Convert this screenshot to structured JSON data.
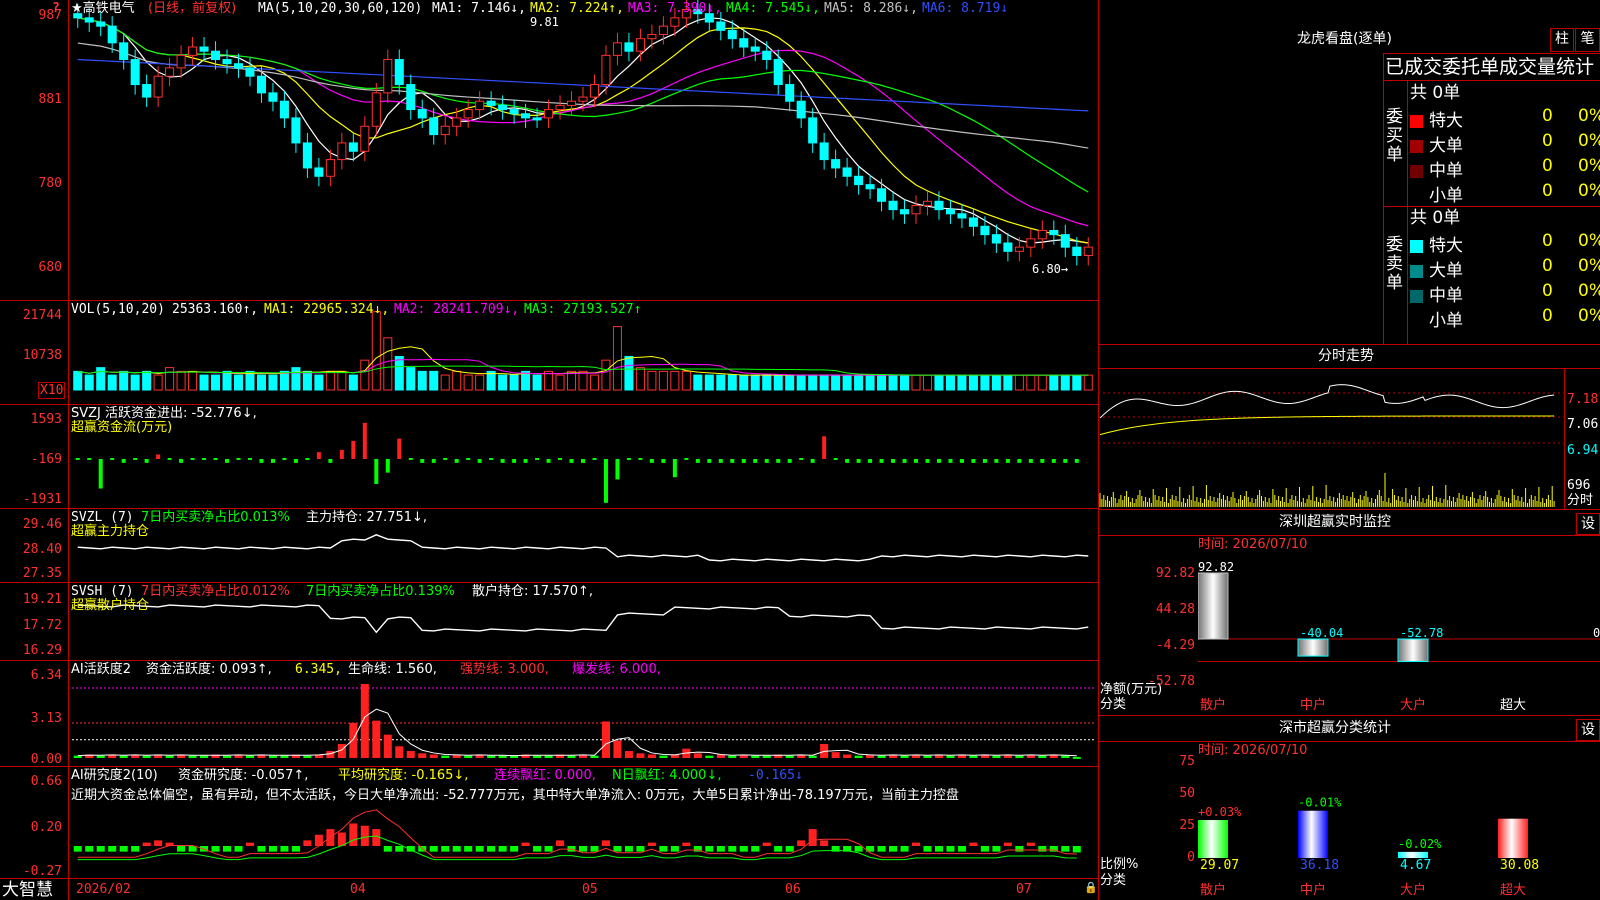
{
  "colors": {
    "up": "#ff3030",
    "down": "#00ffff",
    "frame": "#c00000",
    "ma1": "#ffffff",
    "ma2": "#ffff00",
    "ma3": "#ff00ff",
    "ma4": "#00ff00",
    "ma5": "#c0c0c0",
    "ma6": "#3050ff"
  },
  "header": {
    "corner": "?",
    "stock": "★高铁电气",
    "period": "(日线，前复权)",
    "ma_params": "MA(5,10,20,30,60,120)",
    "ma1": "MA1: 7.146↓,",
    "ma2": "MA2: 7.224↑,",
    "ma3": "MA3: 7.390↓,",
    "ma4": "MA4: 7.545↓,",
    "ma5": "MA5: 8.286↓,",
    "ma6": "MA6: 8.719↓",
    "high_mark": "9.81",
    "low_mark": "6.80→"
  },
  "price_axis": [
    "987",
    "881",
    "780",
    "680"
  ],
  "vol": {
    "label": "VOL(5,10,20)",
    "v": "25363.160↑,",
    "ma1": "MA1: 22965.324↓,",
    "ma2": "MA2: 28241.709↓,",
    "ma3": "MA3: 27193.527↑",
    "axis": [
      "21744",
      "10738"
    ],
    "unit": "X10"
  },
  "svzj": {
    "label": "SVZJ  活跃资金进出: -52.776↓,",
    "sub": "超赢资金流(万元)",
    "axis": [
      "1593",
      "-169",
      "-1931"
    ]
  },
  "svzl": {
    "label": "SVZL (7)",
    "a": "7日内买卖净占比0.013%",
    "b": "主力持仓: 27.751↓,",
    "sub": "超赢主力持仓",
    "axis": [
      "29.46",
      "28.40",
      "27.35"
    ]
  },
  "svsh": {
    "label": "SVSH (7)",
    "a": "7日内买卖净占比0.012%",
    "b": "7日内买卖净占比0.139%",
    "c": "散户持仓: 17.570↑,",
    "sub": "超赢散户持仓",
    "axis": [
      "19.21",
      "17.72",
      "16.29"
    ]
  },
  "ai1": {
    "label": "AI活跃度2",
    "a": "资金活跃度: 0.093↑,",
    "b": "6.345,",
    "c": "生命线: 1.560,",
    "d": "强势线: 3.000,",
    "e": "爆发线: 6.000,",
    "axis": [
      "6.34",
      "3.13",
      "0.00"
    ]
  },
  "ai2": {
    "label": "AI研究度2(10)",
    "a": "资金研究度: -0.057↑,",
    "b": "平均研究度: -0.165↓,",
    "c": "连续飘红: 0.000,",
    "d": "N日飘红: 4.000↓,",
    "e": "-0.165↓",
    "text": "近期大资金总体偏空，虽有异动，但不太活跃，今日大单净流出: -52.777万元，其中特大单净流入: 0万元，大单5日累计净出-78.197万元，当前主力控盘",
    "axis": [
      "0.66",
      "0.20",
      "-0.27"
    ]
  },
  "xaxis": {
    "brand": "大智慧",
    "labels": [
      "2026/02",
      "04",
      "05",
      "06",
      "07"
    ]
  },
  "dragon": {
    "title": "龙虎看盘(逐单)",
    "btn1": "柱",
    "btn2": "笔",
    "subtitle": "已成交委托单成交量统计",
    "buy": {
      "side": "委买单",
      "total": "共 0单",
      "rows": [
        {
          "name": "特大",
          "v": "0",
          "p": "0%"
        },
        {
          "name": "大单",
          "v": "0",
          "p": "0%"
        },
        {
          "name": "中单",
          "v": "0",
          "p": "0%"
        },
        {
          "name": "小单",
          "v": "0",
          "p": "0%"
        }
      ]
    },
    "sell": {
      "side": "委卖单",
      "total": "共 0单",
      "rows": [
        {
          "name": "特大",
          "v": "0",
          "p": "0%"
        },
        {
          "name": "大单",
          "v": "0",
          "p": "0%"
        },
        {
          "name": "中单",
          "v": "0",
          "p": "0%"
        },
        {
          "name": "小单",
          "v": "0",
          "p": "0%"
        }
      ]
    }
  },
  "intraday": {
    "title": "分时走势",
    "axis": [
      "7.18",
      "7.06",
      "6.94"
    ],
    "vol": "696",
    "vol_label": "分时"
  },
  "sz_monitor": {
    "title": "深圳超赢实时监控",
    "set": "设",
    "time": "时间: 2026/07/10",
    "axis": [
      "92.82",
      "44.28",
      "-4.29",
      "-52.78"
    ],
    "ylabel": "净额(万元)",
    "xlabel": "分类",
    "cats": [
      "散户",
      "中户",
      "大户",
      "超大"
    ],
    "values": [
      "92.82",
      "-40.04",
      "-52.78",
      "0"
    ]
  },
  "sz_class": {
    "title": "深市超赢分类统计",
    "set": "设",
    "time": "时间: 2026/07/10",
    "axis": [
      "75",
      "50",
      "25",
      "0"
    ],
    "ylabel": "比例%",
    "xlabel": "分类",
    "cats": [
      "散户",
      "中户",
      "大户",
      "超大"
    ],
    "pct": [
      "29.07",
      "36.18",
      "4.67",
      "30.08"
    ],
    "chg": [
      "+0.03%",
      "-0.01%",
      "-0.02%",
      ""
    ]
  },
  "chart_data": [
    {
      "type": "candlestick",
      "title": "高铁电气 (日线，前复权)",
      "x": [
        "2026/02",
        "04",
        "05",
        "06",
        "07"
      ],
      "y_ticks": [
        9.87,
        8.81,
        7.8,
        6.8
      ],
      "high": 9.81,
      "low": 6.8,
      "ma": {
        "MA1": 7.146,
        "MA2": 7.224,
        "MA3": 7.39,
        "MA4": 7.545,
        "MA5": 8.286,
        "MA6": 8.719
      },
      "close": [
        9.8,
        9.75,
        9.7,
        9.5,
        9.3,
        9.0,
        8.85,
        9.1,
        9.2,
        9.35,
        9.45,
        9.4,
        9.3,
        9.25,
        9.2,
        9.1,
        8.9,
        8.8,
        8.6,
        8.3,
        8.0,
        7.9,
        8.1,
        8.3,
        8.2,
        8.5,
        8.9,
        9.3,
        9.0,
        8.7,
        8.6,
        8.4,
        8.5,
        8.6,
        8.7,
        8.8,
        8.75,
        8.7,
        8.65,
        8.6,
        8.6,
        8.7,
        8.75,
        8.8,
        8.85,
        9.0,
        9.35,
        9.5,
        9.4,
        9.55,
        9.6,
        9.7,
        9.8,
        9.9,
        9.85,
        9.75,
        9.65,
        9.55,
        9.45,
        9.4,
        9.3,
        9.0,
        8.8,
        8.6,
        8.3,
        8.1,
        8.0,
        7.9,
        7.8,
        7.75,
        7.6,
        7.5,
        7.45,
        7.55,
        7.6,
        7.5,
        7.45,
        7.4,
        7.3,
        7.2,
        7.1,
        7.0,
        7.05,
        7.15,
        7.25,
        7.2,
        7.05,
        6.95,
        7.05
      ],
      "up": [
        0,
        0,
        0,
        0,
        0,
        0,
        0,
        1,
        1,
        1,
        1,
        0,
        0,
        0,
        0,
        0,
        0,
        0,
        0,
        0,
        0,
        0,
        1,
        1,
        0,
        1,
        1,
        1,
        0,
        0,
        0,
        0,
        1,
        1,
        1,
        1,
        0,
        0,
        0,
        0,
        0,
        1,
        1,
        1,
        1,
        1,
        1,
        1,
        0,
        1,
        1,
        1,
        1,
        1,
        0,
        0,
        0,
        0,
        0,
        0,
        0,
        0,
        0,
        0,
        0,
        0,
        0,
        0,
        0,
        0,
        0,
        0,
        0,
        1,
        1,
        0,
        0,
        0,
        0,
        0,
        0,
        0,
        1,
        1,
        1,
        0,
        0,
        0,
        1
      ]
    },
    {
      "type": "bar",
      "title": "VOL(5,10,20)",
      "series": [
        {
          "name": "VOL",
          "values": [
            5,
            4,
            6,
            4,
            5,
            4,
            5,
            4,
            6,
            5,
            5,
            4,
            4,
            5,
            4,
            5,
            4,
            4,
            5,
            6,
            5,
            4,
            5,
            5,
            4,
            8,
            21,
            14,
            9,
            6,
            5,
            5,
            4,
            5,
            4,
            4,
            5,
            4,
            4,
            5,
            4,
            5,
            4,
            5,
            5,
            4,
            8,
            17,
            9,
            6,
            5,
            5,
            5,
            5,
            4,
            4,
            4,
            4,
            4,
            4,
            4,
            4,
            4,
            4,
            4,
            4,
            4,
            4,
            4,
            4,
            4,
            4,
            4,
            4,
            4,
            4,
            4,
            4,
            4,
            4,
            4,
            4,
            4,
            4,
            4,
            4,
            4,
            4,
            4
          ]
        }
      ],
      "ma": {
        "MA1": 22965.324,
        "MA2": 28241.709,
        "MA3": 27193.527
      }
    },
    {
      "type": "bar",
      "title": "SVZJ 活跃资金进出",
      "series": [
        {
          "name": "活跃资金进出",
          "values": [
            0,
            0,
            -1300,
            0,
            -169,
            0,
            -169,
            200,
            0,
            -169,
            0,
            0,
            0,
            -169,
            0,
            0,
            -169,
            -169,
            0,
            -169,
            0,
            300,
            -169,
            400,
            800,
            1593,
            -1100,
            -600,
            900,
            0,
            -169,
            -169,
            0,
            -169,
            0,
            -169,
            0,
            -169,
            -169,
            -169,
            0,
            -169,
            0,
            -169,
            -169,
            0,
            -1931,
            -900,
            0,
            0,
            -169,
            -169,
            -800,
            0,
            -169,
            -169,
            -169,
            -169,
            -169,
            -169,
            -169,
            -169,
            -169,
            0,
            -169,
            1000,
            0,
            -169,
            -169,
            -169,
            -169,
            -169,
            -169,
            -169,
            -169,
            -169,
            -169,
            -169,
            -169,
            -169,
            -169,
            -169,
            -169,
            -169,
            -169,
            -169,
            -169,
            -169
          ]
        }
      ]
    },
    {
      "type": "line",
      "title": "SVZL 超赢主力持仓",
      "y_ticks": [
        29.46,
        28.4,
        27.35
      ]
    },
    {
      "type": "line",
      "title": "SVSH 超赢散户持仓",
      "y_ticks": [
        19.21,
        17.72,
        16.29
      ]
    },
    {
      "type": "bar",
      "title": "AI活跃度2",
      "y_ticks": [
        6.34,
        3.13,
        0.0
      ],
      "reference": {
        "生命线": 1.56,
        "强势线": 3.0,
        "爆发线": 6.0
      },
      "series": [
        {
          "name": "资金活跃度",
          "values": [
            0.2,
            0.3,
            0.2,
            0.3,
            0.2,
            0.3,
            0.2,
            0.3,
            0.2,
            0.3,
            0.2,
            0.2,
            0.3,
            0.2,
            0.3,
            0.2,
            0.3,
            0.2,
            0.2,
            0.3,
            0.2,
            0.3,
            0.6,
            1.2,
            3.0,
            6.34,
            3.2,
            2.0,
            1.0,
            0.6,
            0.4,
            0.3,
            0.2,
            0.3,
            0.2,
            0.3,
            0.2,
            0.2,
            0.2,
            0.3,
            0.2,
            0.2,
            0.3,
            0.2,
            0.3,
            0.2,
            3.13,
            1.5,
            0.6,
            0.4,
            0.3,
            0.2,
            0.3,
            0.8,
            0.4,
            0.2,
            0.3,
            0.2,
            0.3,
            0.2,
            0.2,
            0.3,
            0.2,
            0.3,
            0.2,
            1.2,
            0.5,
            0.3,
            0.2,
            0.3,
            0.2,
            0.3,
            0.2,
            0.3,
            0.2,
            0.3,
            0.2,
            0.3,
            0.2,
            0.3,
            0.2,
            0.3,
            0.2,
            0.3,
            0.2,
            0.3,
            0.2,
            0.093
          ]
        }
      ]
    },
    {
      "type": "bar",
      "title": "AI研究度2(10)",
      "y_ticks": [
        0.66,
        0.2,
        -0.27
      ],
      "series": [
        {
          "name": "资金研究度",
          "values": [
            -0.05,
            -0.05,
            -0.05,
            -0.05,
            -0.05,
            -0.05,
            0.03,
            0.05,
            0.03,
            -0.05,
            -0.05,
            -0.05,
            -0.05,
            -0.05,
            -0.05,
            0.03,
            -0.05,
            -0.05,
            -0.05,
            -0.05,
            0.05,
            0.1,
            0.15,
            0.12,
            0.2,
            0.18,
            0.15,
            -0.05,
            -0.05,
            -0.05,
            -0.05,
            -0.05,
            -0.05,
            -0.05,
            -0.05,
            -0.05,
            -0.05,
            -0.05,
            -0.05,
            0.03,
            -0.05,
            -0.05,
            0.05,
            -0.05,
            -0.05,
            -0.05,
            0.05,
            -0.05,
            -0.05,
            -0.05,
            0.03,
            -0.05,
            -0.05,
            0.03,
            -0.05,
            -0.05,
            -0.05,
            -0.05,
            -0.05,
            -0.05,
            0.03,
            -0.05,
            -0.05,
            0.05,
            0.15,
            0.05,
            -0.05,
            -0.05,
            -0.05,
            -0.05,
            -0.05,
            -0.05,
            -0.05,
            0.03,
            -0.05,
            -0.05,
            -0.05,
            -0.05,
            0.03,
            -0.05,
            -0.05,
            0.03,
            -0.05,
            0.03,
            -0.05,
            -0.05,
            -0.05,
            -0.057
          ]
        }
      ]
    },
    {
      "type": "bar",
      "title": "深圳超赢实时监控",
      "categories": [
        "散户",
        "中户",
        "大户",
        "超大"
      ],
      "values": [
        92.82,
        -40.04,
        -52.78,
        0
      ],
      "ylabel": "净额(万元)",
      "y_ticks": [
        92.82,
        44.28,
        -4.29,
        -52.78
      ]
    },
    {
      "type": "bar",
      "title": "深市超赢分类统计",
      "categories": [
        "散户",
        "中户",
        "大户",
        "超大"
      ],
      "values": [
        29.07,
        36.18,
        4.67,
        30.08
      ],
      "ylabel": "比例%",
      "y_ticks": [
        75,
        50,
        25,
        0
      ]
    }
  ]
}
